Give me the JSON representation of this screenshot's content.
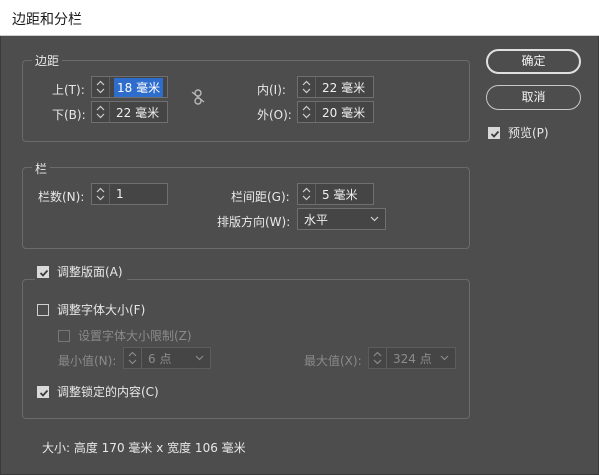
{
  "window": {
    "title": "边距和分栏"
  },
  "buttons": {
    "ok": "确定",
    "cancel": "取消"
  },
  "preview": {
    "label": "预览(P)",
    "checked": true
  },
  "margins": {
    "title": "边距",
    "top": {
      "label": "上(T):",
      "value": "18 毫米"
    },
    "bottom": {
      "label": "下(B):",
      "value": "22 毫米"
    },
    "inside": {
      "label": "内(I):",
      "value": "22 毫米"
    },
    "outside": {
      "label": "外(O):",
      "value": "20 毫米"
    },
    "link_icon": "chain-link-broken-icon"
  },
  "columns": {
    "title": "栏",
    "count": {
      "label": "栏数(N):",
      "value": "1"
    },
    "gutter": {
      "label": "栏间距(G):",
      "value": "5 毫米"
    },
    "direction": {
      "label": "排版方向(W):",
      "value": "水平"
    }
  },
  "adjust": {
    "layout": {
      "label": "调整版面(A)",
      "checked": true
    },
    "font_size": {
      "label": "调整字体大小(F)",
      "checked": false
    },
    "font_limit": {
      "label": "设置字体大小限制(Z)",
      "checked": false,
      "disabled": true
    },
    "min": {
      "label": "最小值(N):",
      "value": "6 点"
    },
    "max": {
      "label": "最大值(X):",
      "value": "324 点"
    },
    "locked": {
      "label": "调整锁定的内容(C)",
      "checked": true
    }
  },
  "footer": {
    "size_text": "大小:  高度 170 毫米 x 宽度 106 毫米"
  },
  "colors": {
    "dialog_bg": "#4d4d4d",
    "selection": "#2f6dcd",
    "border": "#6a6a6a"
  }
}
